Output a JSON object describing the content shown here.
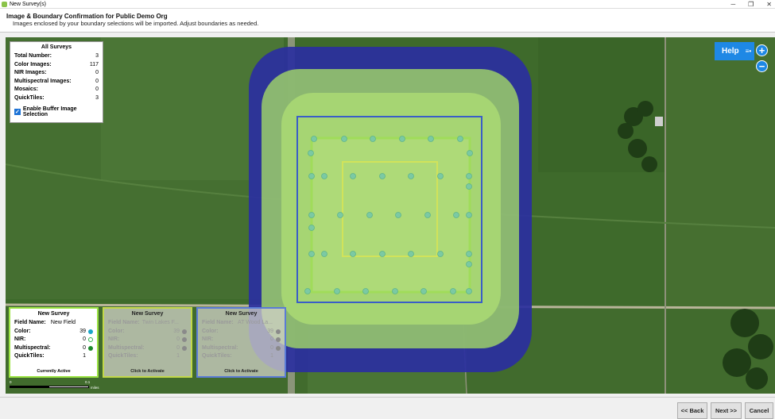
{
  "window": {
    "title": "New Survey(s)",
    "minimize": "─",
    "maximize": "❐",
    "close": "✕"
  },
  "header": {
    "title": "Image & Boundary Confirmation for Public Demo Org",
    "subtitle": "Images enclosed by your boundary selections will be imported. Adjust boundaries as needed."
  },
  "info": {
    "title": "All Surveys",
    "rows": [
      {
        "label": "Total Number:",
        "value": "3"
      },
      {
        "label": "Color Images:",
        "value": "117"
      },
      {
        "label": "NIR Images:",
        "value": "0"
      },
      {
        "label": "Multispectral Images:",
        "value": "0"
      },
      {
        "label": "Mosaics:",
        "value": "0"
      },
      {
        "label": "QuickTiles:",
        "value": "3"
      }
    ],
    "buffer_label": "Enable Buffer Image Selection",
    "buffer_checked": true
  },
  "help": {
    "label": "Help",
    "menu_icon": "≡•"
  },
  "zoom": {
    "in": "+",
    "out": "−"
  },
  "cards": [
    {
      "title": "New Survey",
      "field_label": "Field Name:",
      "field_value": "New Field",
      "color_label": "Color:",
      "color_value": "39",
      "nir_label": "NIR:",
      "nir_value": "0",
      "ms_label": "Multispectral:",
      "ms_value": "0",
      "qt_label": "QuickTiles:",
      "qt_value": "1",
      "footer": "Currently Active"
    },
    {
      "title": "New Survey",
      "field_label": "Field Name:",
      "field_value": "Twin Lakes F...",
      "color_label": "Color:",
      "color_value": "39",
      "nir_label": "NIR:",
      "nir_value": "0",
      "ms_label": "Multispectral:",
      "ms_value": "0",
      "qt_label": "QuickTiles:",
      "qt_value": "1",
      "footer": "Click to Activate"
    },
    {
      "title": "New Survey",
      "field_label": "Field Name:",
      "field_value": "AT Wood La...",
      "color_label": "Color:",
      "color_value": "39",
      "nir_label": "NIR:",
      "nir_value": "0",
      "ms_label": "Multispectral:",
      "ms_value": "0",
      "qt_label": "QuickTiles:",
      "qt_value": "1",
      "footer": "Click to Activate"
    }
  ],
  "scale": {
    "left": "0",
    "right": "0.1",
    "unit": "miles"
  },
  "footer": {
    "back": "<< Back",
    "next": "Next >>",
    "cancel": "Cancel"
  }
}
